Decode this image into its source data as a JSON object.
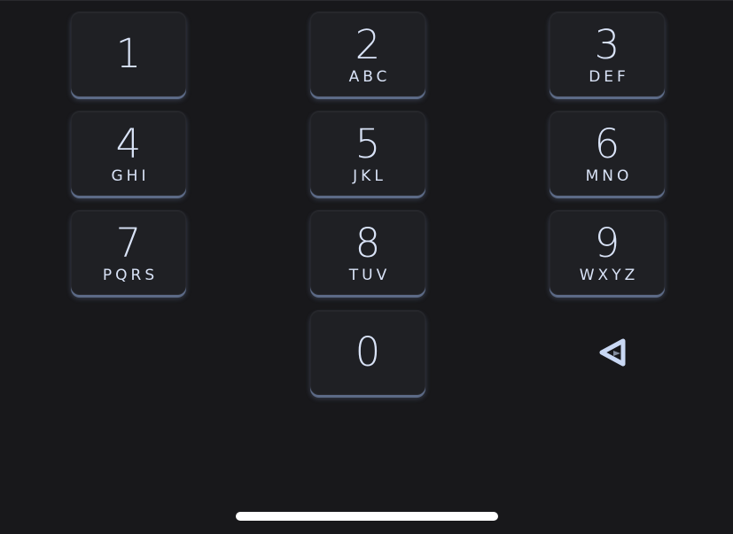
{
  "keypad": {
    "keys": [
      {
        "digit": "1",
        "letters": ""
      },
      {
        "digit": "2",
        "letters": "ABC"
      },
      {
        "digit": "3",
        "letters": "DEF"
      },
      {
        "digit": "4",
        "letters": "GHI"
      },
      {
        "digit": "5",
        "letters": "JKL"
      },
      {
        "digit": "6",
        "letters": "MNO"
      },
      {
        "digit": "7",
        "letters": "PQRS"
      },
      {
        "digit": "8",
        "letters": "TUV"
      },
      {
        "digit": "9",
        "letters": "WXYZ"
      },
      {
        "digit": "0",
        "letters": ""
      }
    ],
    "backspace_icon": "backspace-triangle-icon"
  },
  "colors": {
    "background": "#18181b",
    "key_fill": "#1f2024",
    "key_text": "#d9e3f7",
    "key_shadow": "#5c6a86",
    "home_indicator": "#ffffff"
  }
}
